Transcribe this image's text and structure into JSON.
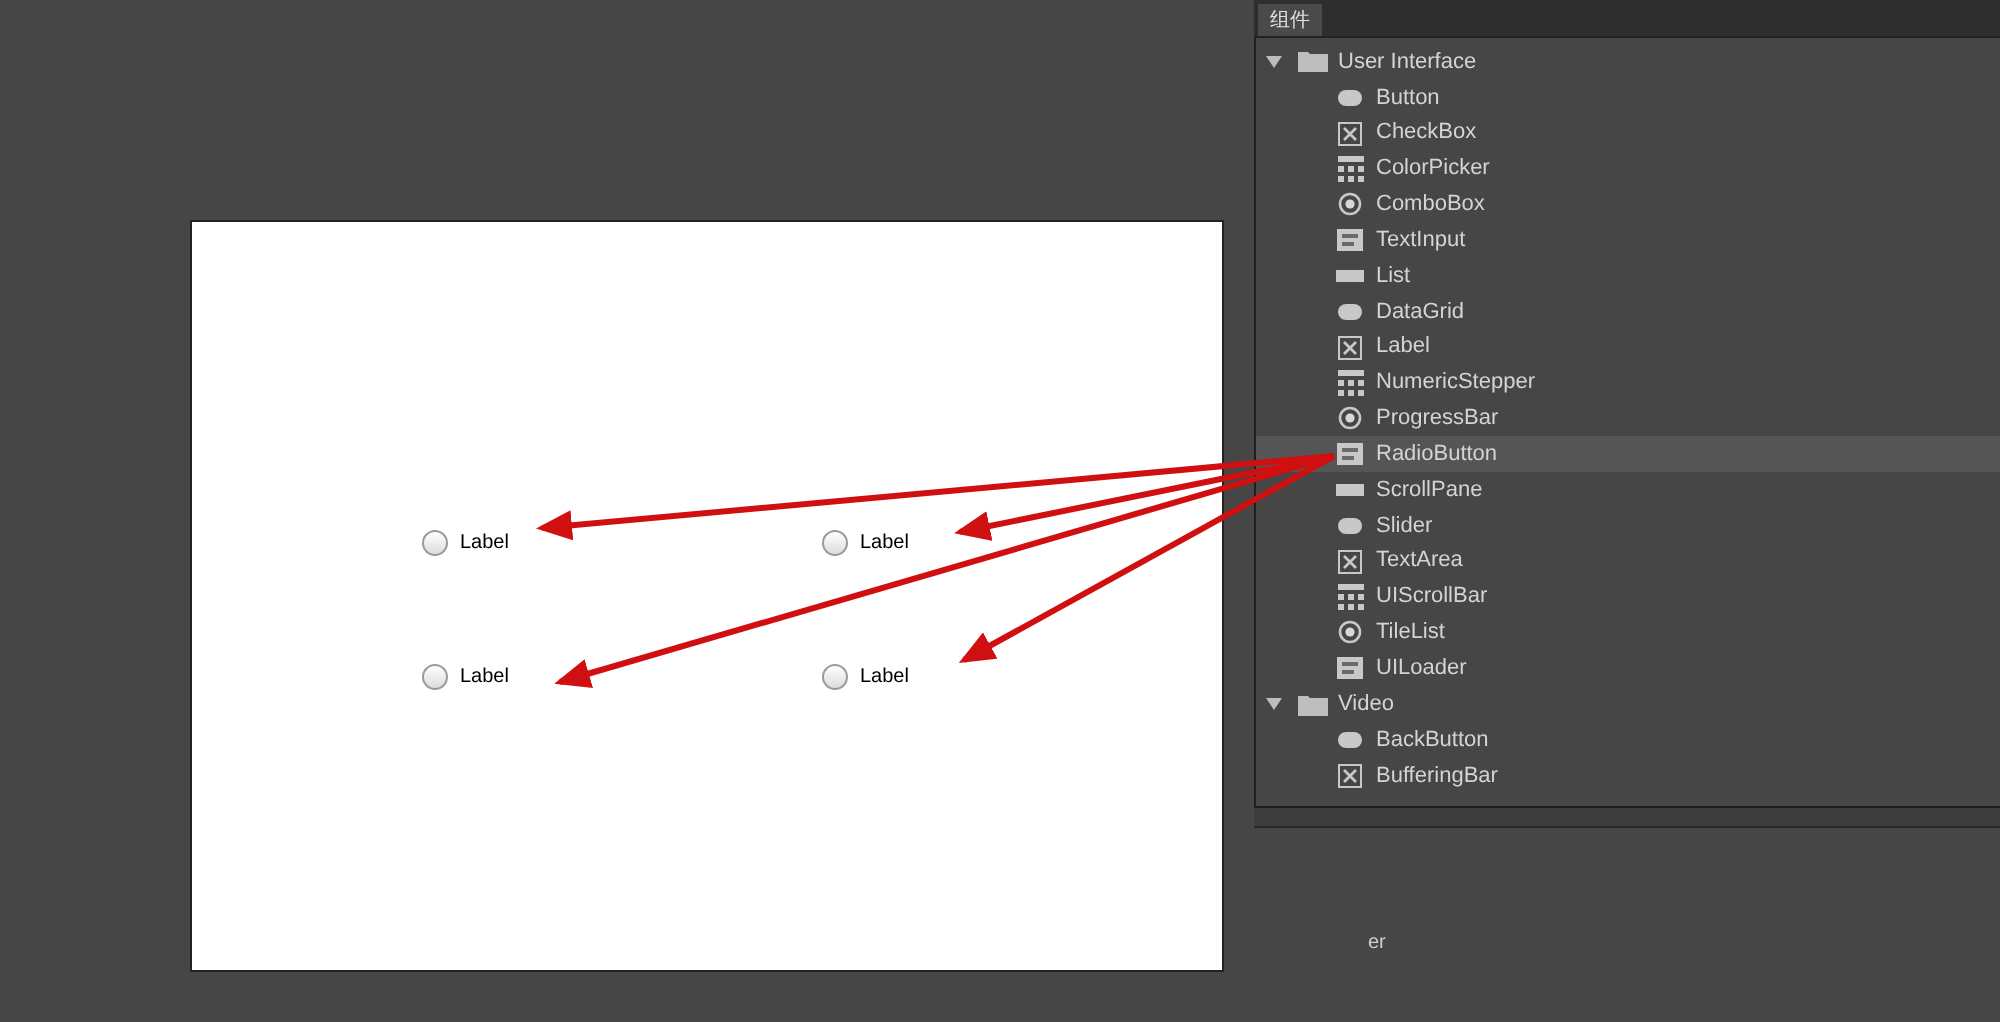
{
  "stage": {
    "radios": [
      {
        "label": "Label",
        "selected": false
      },
      {
        "label": "Label",
        "selected": false
      },
      {
        "label": "Label",
        "selected": false
      },
      {
        "label": "Label",
        "selected": false
      }
    ]
  },
  "panel": {
    "tab": "组件",
    "tree": [
      {
        "label": "User Interface",
        "expanded": true,
        "children": [
          {
            "label": "Button",
            "selected": false
          },
          {
            "label": "CheckBox",
            "selected": false
          },
          {
            "label": "ColorPicker",
            "selected": false
          },
          {
            "label": "ComboBox",
            "selected": false
          },
          {
            "label": "TextInput",
            "selected": false
          },
          {
            "label": "List",
            "selected": false
          },
          {
            "label": "DataGrid",
            "selected": false
          },
          {
            "label": "Label",
            "selected": false
          },
          {
            "label": "NumericStepper",
            "selected": false
          },
          {
            "label": "ProgressBar",
            "selected": false
          },
          {
            "label": "RadioButton",
            "selected": true
          },
          {
            "label": "ScrollPane",
            "selected": false
          },
          {
            "label": "Slider",
            "selected": false
          },
          {
            "label": "TextArea",
            "selected": false
          },
          {
            "label": "UIScrollBar",
            "selected": false
          },
          {
            "label": "TileList",
            "selected": false
          },
          {
            "label": "UILoader",
            "selected": false
          }
        ]
      },
      {
        "label": "Video",
        "expanded": true,
        "children": [
          {
            "label": "BackButton",
            "selected": false
          },
          {
            "label": "BufferingBar",
            "selected": false
          }
        ]
      }
    ]
  },
  "stray_text": "er"
}
